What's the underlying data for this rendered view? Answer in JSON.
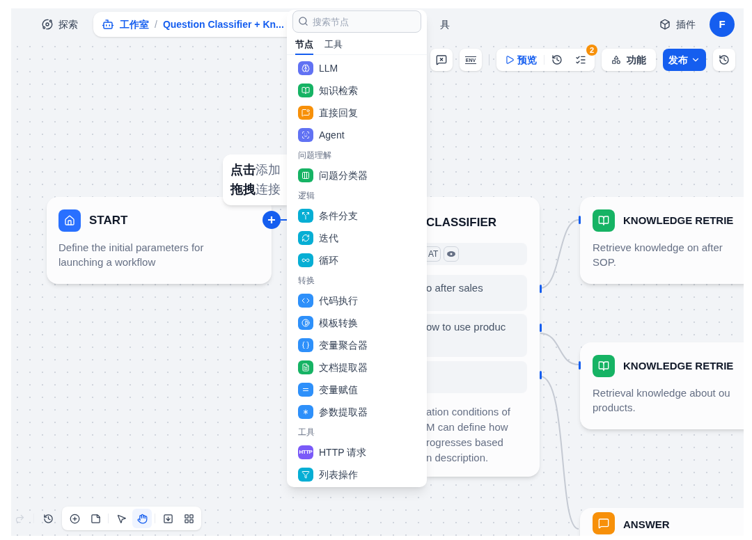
{
  "header": {
    "explore": "探索",
    "breadcrumb": {
      "studio": "工作室",
      "separator": "/",
      "app": "Question Classifier + Kn..."
    },
    "hidden_tail": "具",
    "plugins": "插件",
    "avatar": "F"
  },
  "toolbar": {
    "env": "ENV",
    "preview": "预览",
    "checklist_badge": "2",
    "features": "功能",
    "publish": "发布"
  },
  "picker": {
    "search_placeholder": "搜索节点",
    "tabs": [
      {
        "label": "节点",
        "selected": true
      },
      {
        "label": "工具",
        "selected": false
      }
    ],
    "sections": [
      {
        "items": [
          {
            "label": "LLM",
            "color": "#6172f3"
          },
          {
            "label": "知识检索",
            "color": "#16b364"
          },
          {
            "label": "直接回复",
            "color": "#f79009"
          },
          {
            "label": "Agent",
            "color": "#6172f3"
          }
        ]
      },
      {
        "heading": "问题理解",
        "items": [
          {
            "label": "问题分类器",
            "color": "#16b364"
          }
        ]
      },
      {
        "heading": "逻辑",
        "items": [
          {
            "label": "条件分支",
            "color": "#06aed4"
          },
          {
            "label": "迭代",
            "color": "#06aed4"
          },
          {
            "label": "循环",
            "color": "#06aed4"
          }
        ]
      },
      {
        "heading": "转换",
        "items": [
          {
            "label": "代码执行",
            "color": "#2e90fa"
          },
          {
            "label": "模板转换",
            "color": "#2e90fa"
          },
          {
            "label": "变量聚合器",
            "color": "#2e90fa"
          },
          {
            "label": "文档提取器",
            "color": "#16b364"
          },
          {
            "label": "变量赋值",
            "color": "#2e90fa"
          },
          {
            "label": "参数提取器",
            "color": "#2e90fa"
          }
        ]
      },
      {
        "heading": "工具",
        "items": [
          {
            "label": "HTTP 请求",
            "color": "#7a5af8",
            "icon_text": "HTTP"
          },
          {
            "label": "列表操作",
            "color": "#06aed4"
          }
        ]
      }
    ]
  },
  "tooltip": {
    "lines": [
      "**点击**添加",
      "**拖拽**连接"
    ]
  },
  "start_node": {
    "title": "START",
    "description": "Define the initial parameters for launching a workflow"
  },
  "classifier_node": {
    "title": "CLASSIFIER",
    "chip": "AT",
    "classes": [
      {
        "kind": "text",
        "text": "o after sales"
      },
      {
        "kind": "text",
        "text": "ow to use produc"
      },
      {
        "kind": "blank"
      }
    ],
    "description": [
      "ation conditions of",
      "M can define how",
      "rogresses based",
      "n description."
    ]
  },
  "knowledge_nodes": [
    {
      "title": "KNOWLEDGE RETRIE",
      "description": [
        "Retrieve knowledge on after",
        "SOP."
      ]
    },
    {
      "title": "KNOWLEDGE RETRIE",
      "description": [
        "Retrieval knowledge about ou",
        "products."
      ]
    }
  ],
  "answer_node": {
    "title": "ANSWER"
  },
  "bottom_tools": [
    {
      "selected": false
    },
    {
      "selected": false
    },
    {
      "selected": false
    },
    {
      "selected": true
    },
    {
      "selected": false
    },
    {
      "selected": false
    }
  ]
}
